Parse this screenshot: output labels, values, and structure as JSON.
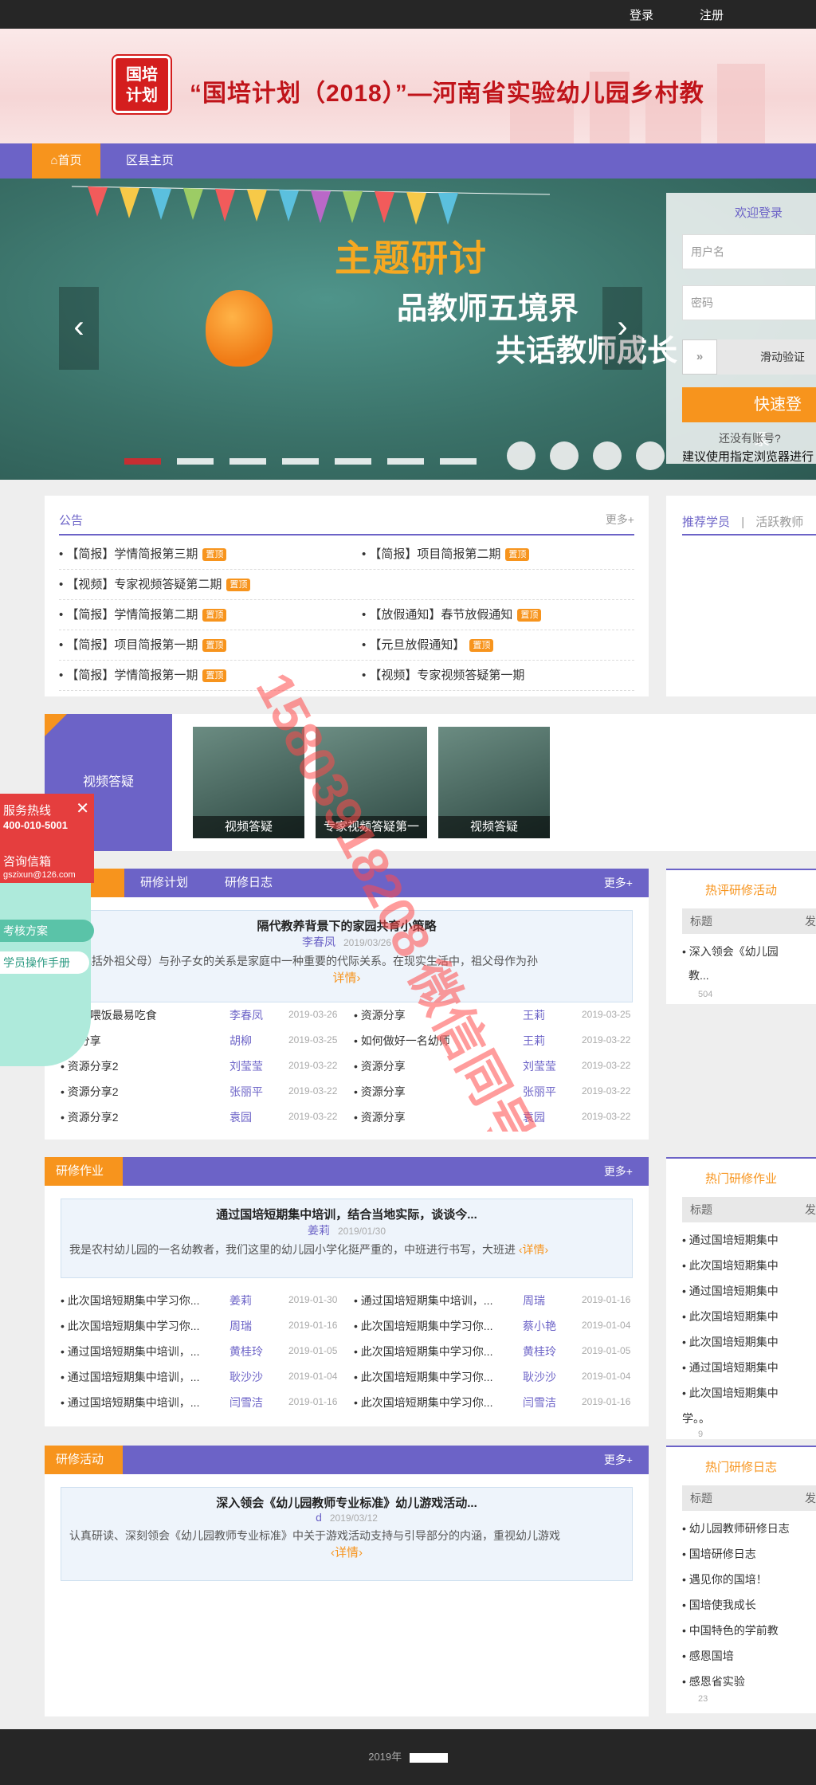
{
  "topbar": {
    "login": "登录",
    "register": "注册"
  },
  "header": {
    "logo_line1": "国培",
    "logo_line2": "计划",
    "title": "“国培计划（2018）”—河南省实验幼儿园乡村教"
  },
  "nav": {
    "home": "首页",
    "county": "区县主页"
  },
  "banner": {
    "line1": "主题研讨",
    "line2": "品教师五境界",
    "line3": "共话教师成长"
  },
  "login": {
    "title": "欢迎登录",
    "username_placeholder": "用户名",
    "password_placeholder": "密码",
    "slide_label": "滑动验证",
    "fast_login": "快速登录",
    "no_account": "还没有账号?",
    "browser_tip": "建议使用指定浏览器进行"
  },
  "notice": {
    "title": "公告",
    "more": "更多+",
    "hot": "置顶",
    "items": [
      {
        "text": "• 【简报】学情简报第三期",
        "hot": true
      },
      {
        "text": "• 【简报】项目简报第二期",
        "hot": true
      },
      {
        "text": "• 【视频】专家视频答疑第二期",
        "hot": true
      },
      {
        "text": "",
        "hot": false
      },
      {
        "text": "• 【简报】学情简报第二期",
        "hot": true
      },
      {
        "text": "• 【放假通知】春节放假通知",
        "hot": true
      },
      {
        "text": "• 【简报】项目简报第一期",
        "hot": true
      },
      {
        "text": "• 【元旦放假通知】",
        "hot": true
      },
      {
        "text": "• 【简报】学情简报第一期",
        "hot": true
      },
      {
        "text": "• 【视频】专家视频答疑第一期",
        "hot": false
      }
    ]
  },
  "recommend": {
    "tab1": "推荐学员",
    "sep": "|",
    "tab2": "活跃教师"
  },
  "video": {
    "label": "视频答疑",
    "thumbs": [
      "视频答疑",
      "专家视频答疑第一",
      "视频答疑"
    ]
  },
  "float": {
    "hotline_label": "服务热线",
    "hotline": "400-010-5001",
    "consult_label": "咨询信箱",
    "email": "gszixun@126.com",
    "plan": "考核方案",
    "manual": "学员操作手册"
  },
  "research": {
    "tab1": "",
    "tab2": "研修计划",
    "tab3": "研修日志",
    "more": "更多+",
    "featured": {
      "title": "隔代教养背景下的家园共育小策略",
      "author": "李春凤",
      "date": "2019/03/26",
      "excerpt": "（包括外祖父母）与孙子女的关系是家庭中一种重要的代际关系。在现实生活中，祖父母作为孙",
      "detail": "详情›"
    },
    "rows": [
      {
        "t": "• 宝宝喂饭最易吃食",
        "a": "李春凤",
        "d": "2019-03-26",
        "t2": "• 资源分享",
        "a2": "王莉",
        "d2": "2019-03-25"
      },
      {
        "t": "• 源分享",
        "a": "胡柳",
        "d": "2019-03-25",
        "t2": "• 如何做好一名幼师",
        "a2": "王莉",
        "d2": "2019-03-22"
      },
      {
        "t": "• 资源分享2",
        "a": "刘莹莹",
        "d": "2019-03-22",
        "t2": "• 资源分享",
        "a2": "刘莹莹",
        "d2": "2019-03-22"
      },
      {
        "t": "• 资源分享2",
        "a": "张丽平",
        "d": "2019-03-22",
        "t2": "• 资源分享",
        "a2": "张丽平",
        "d2": "2019-03-22"
      },
      {
        "t": "• 资源分享2",
        "a": "袁园",
        "d": "2019-03-22",
        "t2": "• 资源分享",
        "a2": "袁园",
        "d2": "2019-03-22"
      }
    ]
  },
  "side1": {
    "title": "热评研修活动",
    "head": "标题",
    "head2": "发",
    "rows": [
      "• 深入领会《幼儿园",
      "教..."
    ],
    "count": "504"
  },
  "homework": {
    "tab": "研修作业",
    "more": "更多+",
    "featured": {
      "title": "通过国培短期集中培训，结合当地实际，谈谈今...",
      "author": "姜莉",
      "date": "2019/01/30",
      "excerpt": "我是农村幼儿园的一名幼教者，我们这里的幼儿园小学化挺严重的，中班进行书写，大班进",
      "detail": "‹详情›"
    },
    "rows": [
      {
        "t": "• 此次国培短期集中学习你...",
        "a": "姜莉",
        "d": "2019-01-30",
        "t2": "• 通过国培短期集中培训，...",
        "a2": "周瑞",
        "d2": "2019-01-16"
      },
      {
        "t": "• 此次国培短期集中学习你...",
        "a": "周瑞",
        "d": "2019-01-16",
        "t2": "• 此次国培短期集中学习你...",
        "a2": "蔡小艳",
        "d2": "2019-01-04"
      },
      {
        "t": "• 通过国培短期集中培训，...",
        "a": "黄桂玲",
        "d": "2019-01-05",
        "t2": "• 此次国培短期集中学习你...",
        "a2": "黄桂玲",
        "d2": "2019-01-05"
      },
      {
        "t": "• 通过国培短期集中培训，...",
        "a": "耿沙沙",
        "d": "2019-01-04",
        "t2": "• 此次国培短期集中学习你...",
        "a2": "耿沙沙",
        "d2": "2019-01-04"
      },
      {
        "t": "• 通过国培短期集中培训，...",
        "a": "闫雪洁",
        "d": "2019-01-16",
        "t2": "• 此次国培短期集中学习你...",
        "a2": "闫雪洁",
        "d2": "2019-01-16"
      }
    ]
  },
  "side2": {
    "title": "热门研修作业",
    "head": "标题",
    "head2": "发",
    "rows": [
      "• 通过国培短期集中",
      "• 此次国培短期集中",
      "• 通过国培短期集中",
      "• 此次国培短期集中",
      "• 此次国培短期集中",
      "• 通过国培短期集中",
      "• 此次国培短期集中",
      "学。。"
    ],
    "count": "9"
  },
  "activity": {
    "tab": "研修活动",
    "more": "更多+",
    "featured": {
      "title": "深入领会《幼儿园教师专业标准》幼儿游戏活动...",
      "author": "d",
      "date": "2019/03/12",
      "excerpt": "认真研读、深刻领会《幼儿园教师专业标准》中关于游戏活动支持与引导部分的内涵，重视幼儿游戏",
      "detail": "‹详情›"
    }
  },
  "side3": {
    "title": "热门研修日志",
    "head": "标题",
    "head2": "发",
    "rows": [
      "• 幼儿园教师研修日志",
      "• 国培研修日志",
      "• 遇见你的国培！",
      "• 国培使我成长",
      "• 中国特色的学前教",
      "• 感恩国培",
      "• 感恩省实验"
    ],
    "count": "23"
  },
  "footer": {
    "text": "2019年"
  },
  "watermark": {
    "text": "15803918208 微信同号"
  },
  "colors": {
    "accent": "#6c63c7",
    "orange": "#f7941d",
    "brand_red": "#d41e1e"
  }
}
